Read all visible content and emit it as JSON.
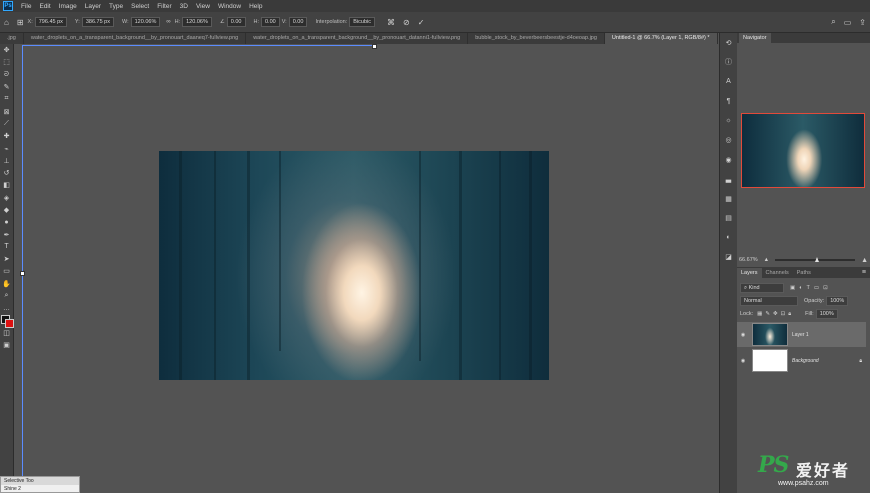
{
  "menu": {
    "logo": "Ps",
    "items": [
      "File",
      "Edit",
      "Image",
      "Layer",
      "Type",
      "Select",
      "Filter",
      "3D",
      "View",
      "Window",
      "Help"
    ]
  },
  "options": {
    "x_label": "X:",
    "x_value": "796.45 px",
    "y_label": "Y:",
    "y_value": "386.75 px",
    "w_label": "W:",
    "w_value": "120.06%",
    "h_label": "H:",
    "h_value": "120.06%",
    "angle_value": "0.00",
    "hskew_label": "H:",
    "hskew_value": "0.00",
    "vskew_label": "V:",
    "vskew_value": "0.00",
    "interp_label": "Interpolation:",
    "interp_value": "Bicubic"
  },
  "tabs": [
    {
      "label": ".jpg"
    },
    {
      "label": "water_droplets_on_a_transparent_background__by_pronouart_daaneq7-fullview.png"
    },
    {
      "label": "water_droplets_on_a_transparent_background__by_pronouart_datanni1-fullview.png"
    },
    {
      "label": "bubble_stock_by_beverbeersbeestje-d4oeoap.jpg"
    },
    {
      "label": "Untitled-1 @ 66.7% (Layer 1, RGB/8#) *"
    }
  ],
  "active_tab_index": 4,
  "navigator": {
    "tab": "Navigator",
    "zoom": "66.67%"
  },
  "layers": {
    "tabs": [
      "Layers",
      "Channels",
      "Paths"
    ],
    "kind_label": "Kind",
    "blend_mode": "Normal",
    "opacity_label": "Opacity:",
    "opacity_value": "100%",
    "lock_label": "Lock:",
    "fill_label": "Fill:",
    "fill_value": "100%",
    "items": [
      {
        "name": "Layer 1",
        "selected": true
      },
      {
        "name": "Background",
        "locked": true
      }
    ]
  },
  "floating_panel": {
    "title": "Selective Too",
    "item": "Shine 2"
  },
  "watermark": {
    "ps": "PS",
    "cn": "爱好者",
    "url": "www.psahz.com"
  },
  "colors": {
    "menubar": "#3a3a3a",
    "panel": "#535353",
    "accent": "#31a8ff",
    "navigator_border": "#e24a3a",
    "watermark_green": "#34a84b"
  }
}
